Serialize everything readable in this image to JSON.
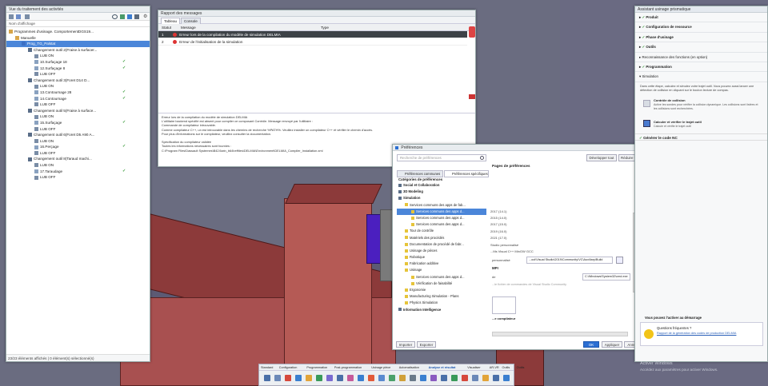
{
  "activity_tree": {
    "title": "Vue du traitement des activités",
    "filter_label": "Nom d'affichage",
    "items": [
      {
        "label": "Programmes d'usinage. ComportementDGS19...",
        "level": 0,
        "icon": "folder-icon"
      },
      {
        "label": "Manuelle",
        "level": 1,
        "icon": "folder-icon"
      },
      {
        "label": "Prog_TG_Palstat",
        "level": 2,
        "icon": "program-icon",
        "selected": true
      },
      {
        "label": "Changement outil 2(Fraise à surfacer...",
        "level": 3,
        "icon": "tool-change-icon"
      },
      {
        "label": "LUB ON",
        "level": 4,
        "icon": "lub-icon"
      },
      {
        "label": "10.Surfaçage 18",
        "level": 4,
        "icon": "op-icon",
        "ok": true
      },
      {
        "label": "12.Surfaçage 8",
        "level": 4,
        "icon": "op-icon",
        "ok": true
      },
      {
        "label": "LUB OFF",
        "level": 4,
        "icon": "lub-icon"
      },
      {
        "label": "Changement outil 3(Foret D14 D...",
        "level": 3,
        "icon": "tool-change-icon"
      },
      {
        "label": "LUB ON",
        "level": 4,
        "icon": "lub-icon"
      },
      {
        "label": "13.Contournage 28",
        "level": 4,
        "icon": "op-icon",
        "ok": true
      },
      {
        "label": "14.Contournage",
        "level": 4,
        "icon": "op-icon",
        "ok": true
      },
      {
        "label": "LUB OFF",
        "level": 4,
        "icon": "lub-icon"
      },
      {
        "label": "Changement outil 5(Fraise à surface...",
        "level": 3,
        "icon": "tool-change-icon"
      },
      {
        "label": "LUB ON",
        "level": 4,
        "icon": "lub-icon"
      },
      {
        "label": "15.Surfaçage",
        "level": 4,
        "icon": "op-icon",
        "ok": true
      },
      {
        "label": "LUB OFF",
        "level": 4,
        "icon": "lub-icon"
      },
      {
        "label": "Changement outil 6(Foret D5 A90 A...",
        "level": 3,
        "icon": "tool-change-icon"
      },
      {
        "label": "LUB ON",
        "level": 4,
        "icon": "lub-icon"
      },
      {
        "label": "16.Perçage",
        "level": 4,
        "icon": "op-icon",
        "ok": true
      },
      {
        "label": "LUB OFF",
        "level": 4,
        "icon": "lub-icon"
      },
      {
        "label": "Changement outil 8(Taraud machi...",
        "level": 3,
        "icon": "tool-change-icon"
      },
      {
        "label": "LUB ON",
        "level": 4,
        "icon": "lub-icon"
      },
      {
        "label": "17.Taraudage",
        "level": 4,
        "icon": "op-icon",
        "ok": true
      },
      {
        "label": "LUB OFF",
        "level": 4,
        "icon": "lub-icon"
      }
    ],
    "status": "23/23 éléments affichés | 0 élément(s) sélectionné(s)"
  },
  "report": {
    "title": "Rapport des messages",
    "tabs": [
      "Tableau",
      "Console"
    ],
    "col_status": "Statut",
    "col_message": "Message",
    "col_type": "Type",
    "rows": [
      {
        "num": "1",
        "message": "Erreur lors de la compilation du modèle de simulation DELMIA",
        "type": ""
      },
      {
        "num": "2",
        "message": "Erreur de l'initialisation de la simulation",
        "type": ""
      }
    ],
    "console": [
      "Erreur lors de la compilation du modèle de simulation DELMIA",
      "L'utilitaire backend spécifié est absent pour compiler ce composant Contrôle. Message renvoyé par l'utilitaire :",
      "Commande de compilateur introuvable.",
      "Comme compilateur C++, un est introuvable dans les chemins de recherche %PATH%. Veuillez installer un compilateur C++ et vérifier le chemin d'accès.",
      "Pour plus d'informations sur le compilateur, veuillez consulter la documentation.",
      "",
      "Spécification du compilateur validée",
      "Toutes les informations nécessaires sont fournies :",
      "C:\\Program Files\\Dassault Systemes\\B424\\win_b64\\reffiles\\DELMIA\\Environment\\DELMIA_Compiler_Installation.xml"
    ]
  },
  "prefs": {
    "title": "Préférences",
    "search_placeholder": "Recherche de préférences",
    "btn_develop": "Développer tout",
    "btn_collapse": "Réduire tout",
    "tabs": [
      "Préférences communes",
      "Préférences spécifiques"
    ],
    "section_heading": "Pages de préférences",
    "categories_heading": "Catégories de préférences",
    "tree": [
      {
        "label": "Social et Collaboration",
        "level": 0,
        "bold": true
      },
      {
        "label": "3D Modeling",
        "level": 0,
        "bold": true
      },
      {
        "label": "Simulation",
        "level": 0,
        "bold": true
      },
      {
        "label": "Services communs des apps de fab...",
        "level": 1
      },
      {
        "label": "Services communs des apps d...",
        "level": 2,
        "selected": true
      },
      {
        "label": "Services communs des apps d...",
        "level": 2
      },
      {
        "label": "Services communs des apps d...",
        "level": 2
      },
      {
        "label": "Tour de contrôle",
        "level": 1
      },
      {
        "label": "Matériels des procédés",
        "level": 1
      },
      {
        "label": "Documentation de procédé de fabr...",
        "level": 1
      },
      {
        "label": "Usinage de pièces",
        "level": 1
      },
      {
        "label": "Robotique",
        "level": 1
      },
      {
        "label": "Fabrication additive",
        "level": 1
      },
      {
        "label": "Usinage",
        "level": 1
      },
      {
        "label": "Services communs des apps d...",
        "level": 2
      },
      {
        "label": "Vérification de faisabilité",
        "level": 2
      },
      {
        "label": "Ergonomie",
        "level": 1
      },
      {
        "label": "Manufacturing Simulation - Plans",
        "level": 1
      },
      {
        "label": "Physics Simulation",
        "level": 1
      },
      {
        "label": "Information Intelligence",
        "level": 0,
        "bold": true
      }
    ],
    "versions": [
      "2017 (14.1)",
      "2015 (14.0)",
      "2017 (15.0)",
      "2019 (16.0)",
      "2021 (17.0)"
    ],
    "row_studio": "Studio personnalisé",
    "row_ms": "...Ms Visual C++ MinGW GCC",
    "label_personalise": "personnalisé",
    "path_value": "...ool\\Visual Studio\\2019\\Community\\VC\\Auxiliary\\Build",
    "label_mpi": "MPI",
    "label_mode": "de",
    "mpi_value": "C:\\Windows\\System32\\cmd.exe",
    "hint": "...le fichier de commandes de Visual Studio Community",
    "label_compiler": "...e compilateur",
    "btn_import": "Importer",
    "btn_export": "Exporter",
    "btn_ok": "OK",
    "btn_apply": "Appliquer",
    "btn_cancel": "Annuler"
  },
  "assistant": {
    "title": "Assistant usinage prismatique",
    "steps": [
      {
        "label": "Produit",
        "done": true
      },
      {
        "label": "Configuration de ressource",
        "done": true
      },
      {
        "label": "Phase d'usinage",
        "done": true
      },
      {
        "label": "Outils",
        "done": true
      },
      {
        "label": "Reconnaissance des fonctions (en option)",
        "done": false
      },
      {
        "label": "Programmation",
        "done": true
      },
      {
        "label": "Simulation",
        "done": false,
        "open": true
      }
    ],
    "sim_text": "Dans cette étape, calculez et simulez votre trajet outil. Vous pouvez aussi lancer une détection de collision en cliquant sur le bouton lecture de compas.",
    "collision_title": "Contrôle de collision",
    "collision_text": "Active les sondes pour vérifier la collision dynamique. Les collisions sont listées et les collisions sont recherchées.",
    "calc_title": "Calculer et vérifier le trajet outil",
    "calc_text": "Calcule et vérifie le trajet outil",
    "final_step": "Générer le code NC",
    "help_title": "Vous pouvez l'activer au démarrage",
    "question": "Questions fréquentes ?",
    "link": "Rapport de la génération des codes de production DELMIA"
  },
  "windows": {
    "line1": "Activer Windows",
    "line2": "Accédez aux paramètres pour activer Windows."
  },
  "toolbar": {
    "tabs": [
      "Standard",
      "Configuration",
      "Programmation",
      "Post-programmation",
      "Usinage pièce",
      "Automatisation",
      "Analyse et résultat",
      "Visualiser",
      "AR-VR",
      "Outils",
      "Outils"
    ],
    "active_tab": "Analyse et résultat"
  }
}
